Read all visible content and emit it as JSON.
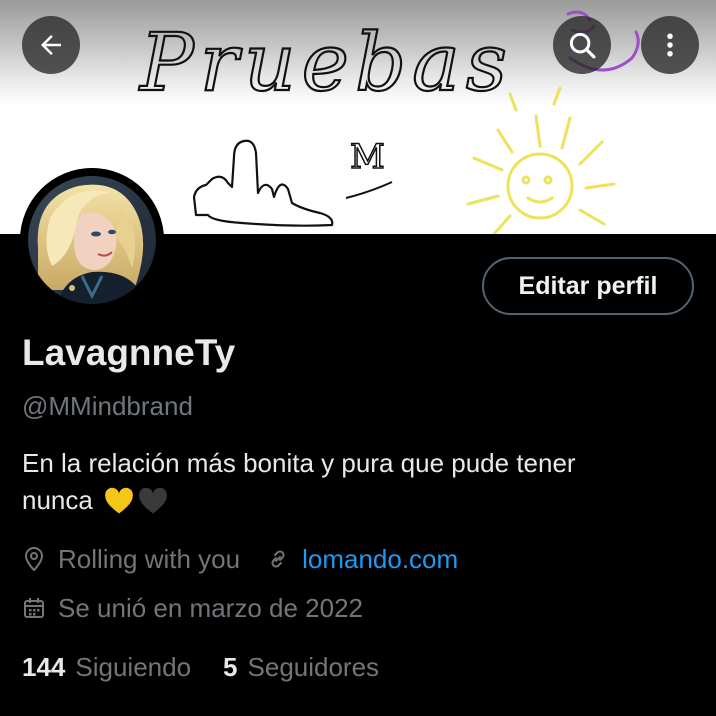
{
  "banner": {
    "handwriting": "Pruebas",
    "small_letter": "M"
  },
  "header": {
    "back_icon": "arrow-left-icon",
    "search_icon": "search-icon",
    "more_icon": "more-vertical-icon"
  },
  "profile": {
    "edit_label": "Editar perfil",
    "display_name": "LavagnneTy",
    "handle": "@MMindbrand",
    "bio_line1": "En la relación más bonita y pura que pude tener",
    "bio_line2": "nunca",
    "bio_emojis": [
      "yellow-heart",
      "black-heart"
    ],
    "location": "Rolling with you",
    "website": "lomando.com",
    "joined": "Se unió en marzo de 2022",
    "following_count": "144",
    "following_label": "Siguiendo",
    "followers_count": "5",
    "followers_label": "Seguidores"
  },
  "colors": {
    "background": "#000000",
    "text_primary": "#e7e9ea",
    "text_secondary": "#71767b",
    "link": "#1d9bf0",
    "button_border": "#536471",
    "heart_yellow": "#f5c518",
    "heart_black": "#3a3a3a"
  }
}
